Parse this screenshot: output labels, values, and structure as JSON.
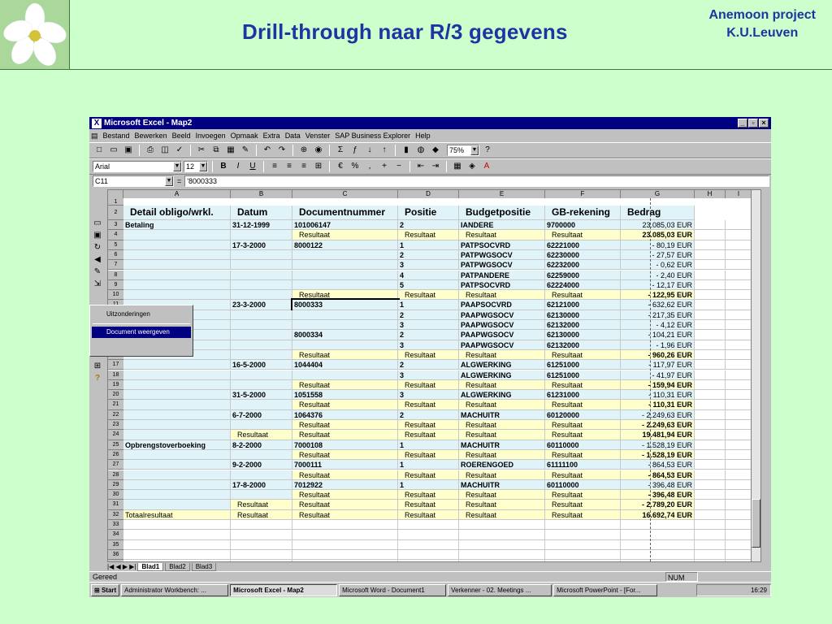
{
  "slide": {
    "title": "Drill-through naar R/3 gegevens",
    "org_line1": "Anemoon project",
    "org_line2": "K.U.Leuven"
  },
  "window": {
    "title": "Microsoft Excel - Map2",
    "menu": [
      "Bestand",
      "Bewerken",
      "Beeld",
      "Invoegen",
      "Opmaak",
      "Extra",
      "Data",
      "Venster",
      "SAP Business Explorer",
      "Help"
    ],
    "zoom": "75%",
    "font_name": "Arial",
    "font_size": "12",
    "name_box": "C11",
    "formula_value": "'8000333"
  },
  "sheet": {
    "columns": [
      "A",
      "B",
      "C",
      "D",
      "E",
      "F",
      "G",
      "H",
      "I"
    ],
    "headers": [
      "Detail obligo/wrkl.",
      "Datum",
      "Documentnummer",
      "Positie",
      "Budgetpositie",
      "GB-rekening",
      "Bedrag"
    ],
    "rows": [
      {
        "n": "3",
        "a": "Betaling",
        "b": "31-12-1999",
        "c": "101006147",
        "d": "2",
        "e": "IANDERE",
        "f": "9700000",
        "g": "23.085,03  EUR",
        "t": "d"
      },
      {
        "n": "4",
        "a": "",
        "b": "",
        "c": "Resultaat",
        "d": "Resultaat",
        "e": "Resultaat",
        "f": "Resultaat",
        "g": "23.085,03  EUR",
        "t": "r"
      },
      {
        "n": "5",
        "a": "",
        "b": "17-3-2000",
        "c": "8000122",
        "d": "1",
        "e": "PATPSOCVRD",
        "f": "62221000",
        "g": "- 80,19  EUR",
        "t": "d"
      },
      {
        "n": "6",
        "a": "",
        "b": "",
        "c": "",
        "d": "2",
        "e": "PATPWGSOCV",
        "f": "62230000",
        "g": "- 27,57  EUR",
        "t": "d"
      },
      {
        "n": "7",
        "a": "",
        "b": "",
        "c": "",
        "d": "3",
        "e": "PATPWGSOCV",
        "f": "62232000",
        "g": "- 0,62  EUR",
        "t": "d"
      },
      {
        "n": "8",
        "a": "",
        "b": "",
        "c": "",
        "d": "4",
        "e": "PATPANDERE",
        "f": "62259000",
        "g": "- 2,40  EUR",
        "t": "d"
      },
      {
        "n": "9",
        "a": "",
        "b": "",
        "c": "",
        "d": "5",
        "e": "PATPSOCVRD",
        "f": "62224000",
        "g": "- 12,17  EUR",
        "t": "d"
      },
      {
        "n": "10",
        "a": "",
        "b": "",
        "c": "Resultaat",
        "d": "Resultaat",
        "e": "Resultaat",
        "f": "Resultaat",
        "g": "- 122,95  EUR",
        "t": "r"
      },
      {
        "n": "11",
        "a": "",
        "b": "23-3-2000",
        "c": "8000333",
        "d": "1",
        "e": "PAAPSOCVRD",
        "f": "62121000",
        "g": "- 632,62  EUR",
        "t": "d"
      },
      {
        "n": "12",
        "a": "",
        "b": "",
        "c": "",
        "d": "2",
        "e": "PAAPWGSOCV",
        "f": "62130000",
        "g": "- 217,35  EUR",
        "t": "d"
      },
      {
        "n": "13",
        "a": "",
        "b": "",
        "c": "",
        "d": "3",
        "e": "PAAPWGSOCV",
        "f": "62132000",
        "g": "- 4,12  EUR",
        "t": "d"
      },
      {
        "n": "14",
        "a": "",
        "b": "",
        "c": "8000334",
        "d": "2",
        "e": "PAAPWGSOCV",
        "f": "62130000",
        "g": "- 104,21  EUR",
        "t": "d"
      },
      {
        "n": "15",
        "a": "",
        "b": "",
        "c": "",
        "d": "3",
        "e": "PAAPWGSOCV",
        "f": "62132000",
        "g": "- 1,96  EUR",
        "t": "d"
      },
      {
        "n": "16",
        "a": "",
        "b": "",
        "c": "Resultaat",
        "d": "Resultaat",
        "e": "Resultaat",
        "f": "Resultaat",
        "g": "- 960,26  EUR",
        "t": "r"
      },
      {
        "n": "17",
        "a": "",
        "b": "16-5-2000",
        "c": "1044404",
        "d": "2",
        "e": "ALGWERKING",
        "f": "61251000",
        "g": "- 117,97  EUR",
        "t": "d"
      },
      {
        "n": "18",
        "a": "",
        "b": "",
        "c": "",
        "d": "3",
        "e": "ALGWERKING",
        "f": "61251000",
        "g": "- 41,97  EUR",
        "t": "d"
      },
      {
        "n": "19",
        "a": "",
        "b": "",
        "c": "Resultaat",
        "d": "Resultaat",
        "e": "Resultaat",
        "f": "Resultaat",
        "g": "- 159,94  EUR",
        "t": "r"
      },
      {
        "n": "20",
        "a": "",
        "b": "31-5-2000",
        "c": "1051558",
        "d": "3",
        "e": "ALGWERKING",
        "f": "61231000",
        "g": "- 110,31  EUR",
        "t": "d"
      },
      {
        "n": "21",
        "a": "",
        "b": "",
        "c": "Resultaat",
        "d": "Resultaat",
        "e": "Resultaat",
        "f": "Resultaat",
        "g": "- 110,31  EUR",
        "t": "r"
      },
      {
        "n": "22",
        "a": "",
        "b": "6-7-2000",
        "c": "1064376",
        "d": "2",
        "e": "MACHUITR",
        "f": "60120000",
        "g": "- 2.249,63  EUR",
        "t": "d"
      },
      {
        "n": "23",
        "a": "",
        "b": "",
        "c": "Resultaat",
        "d": "Resultaat",
        "e": "Resultaat",
        "f": "Resultaat",
        "g": "- 2.249,63  EUR",
        "t": "r"
      },
      {
        "n": "24",
        "a": "",
        "b": "Resultaat",
        "c": "Resultaat",
        "d": "Resultaat",
        "e": "Resultaat",
        "f": "Resultaat",
        "g": "19.481,94  EUR",
        "t": "r"
      },
      {
        "n": "25",
        "a": "Opbrengstoverboeking",
        "b": "8-2-2000",
        "c": "7000108",
        "d": "1",
        "e": "MACHUITR",
        "f": "60110000",
        "g": "- 1.528,19  EUR",
        "t": "d"
      },
      {
        "n": "26",
        "a": "",
        "b": "",
        "c": "Resultaat",
        "d": "Resultaat",
        "e": "Resultaat",
        "f": "Resultaat",
        "g": "- 1.528,19  EUR",
        "t": "r"
      },
      {
        "n": "27",
        "a": "",
        "b": "9-2-2000",
        "c": "7000111",
        "d": "1",
        "e": "ROERENGOED",
        "f": "61111100",
        "g": "- 864,53  EUR",
        "t": "d"
      },
      {
        "n": "28",
        "a": "",
        "b": "",
        "c": "Resultaat",
        "d": "Resultaat",
        "e": "Resultaat",
        "f": "Resultaat",
        "g": "- 864,53  EUR",
        "t": "r"
      },
      {
        "n": "29",
        "a": "",
        "b": "17-8-2000",
        "c": "7012922",
        "d": "1",
        "e": "MACHUITR",
        "f": "60110000",
        "g": "- 396,48  EUR",
        "t": "d"
      },
      {
        "n": "30",
        "a": "",
        "b": "",
        "c": "Resultaat",
        "d": "Resultaat",
        "e": "Resultaat",
        "f": "Resultaat",
        "g": "- 396,48  EUR",
        "t": "r"
      },
      {
        "n": "31",
        "a": "",
        "b": "Resultaat",
        "c": "Resultaat",
        "d": "Resultaat",
        "e": "Resultaat",
        "f": "Resultaat",
        "g": "- 2.789,20  EUR",
        "t": "r"
      },
      {
        "n": "32",
        "a": "Totaalresultaat",
        "b": "Resultaat",
        "c": "Resultaat",
        "d": "Resultaat",
        "e": "Resultaat",
        "f": "Resultaat",
        "g": "16.692,74  EUR",
        "t": "tot"
      }
    ],
    "empty_rows": [
      "33",
      "34",
      "35",
      "36",
      "37"
    ],
    "tabs": [
      "Blad1",
      "Blad2",
      "Blad3"
    ]
  },
  "context_menu": {
    "items": [
      "Uitzonderingen",
      "Document weergeven"
    ]
  },
  "status": {
    "left": "Gereed",
    "num": "NUM"
  },
  "taskbar": {
    "start": "Start",
    "tasks": [
      "Administrator Workbench: ...",
      "Microsoft Excel - Map2",
      "Microsoft Word - Document1",
      "Verkenner - 02. Meetings ...",
      "Microsoft PowerPoint - [For..."
    ],
    "clock": "16:29"
  },
  "colors": {
    "slide_bg": "#ccffcc",
    "title": "#1f34a3",
    "detail_row": "#dff3f9",
    "result_row": "#ffffcc"
  }
}
